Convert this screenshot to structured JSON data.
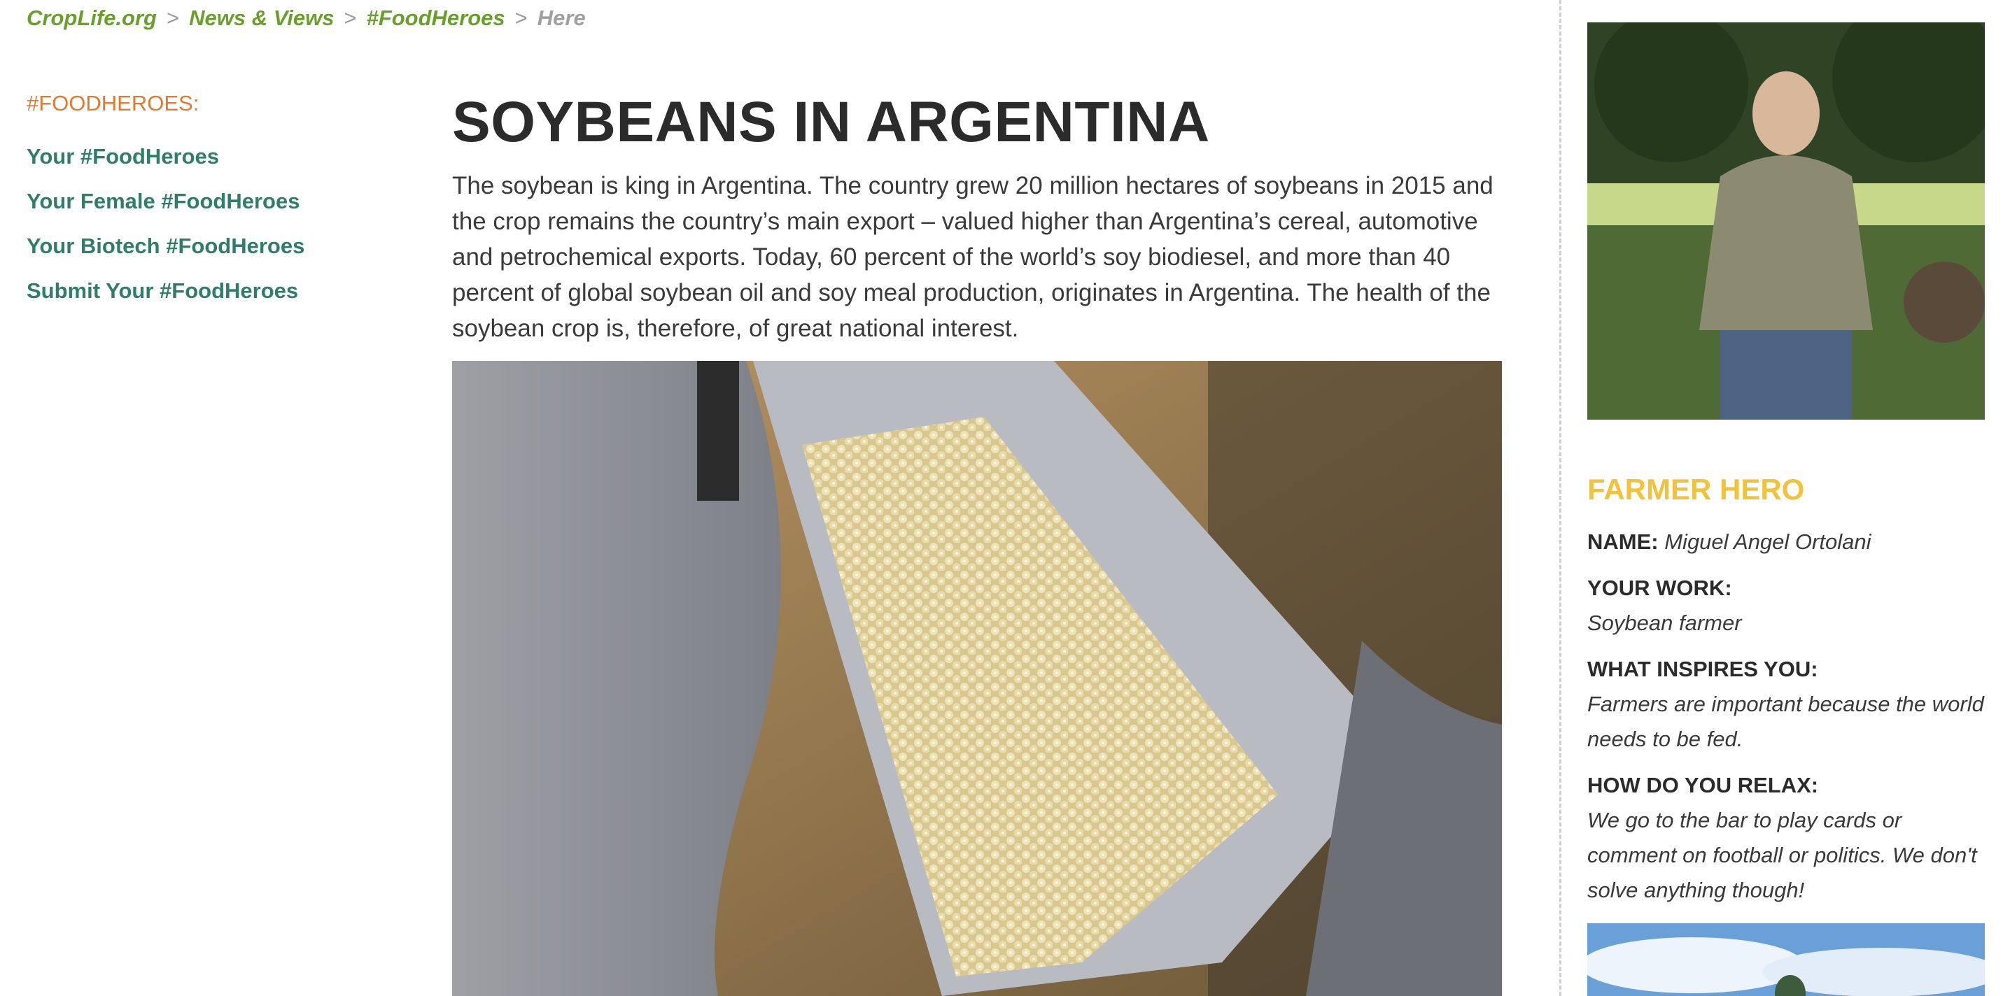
{
  "breadcrumb": {
    "items": [
      "CropLife.org",
      "News & Views",
      "#FoodHeroes"
    ],
    "current": "Here",
    "separator": ">"
  },
  "sidebar": {
    "heading": "#FOODHEROES:",
    "links": [
      "Your #FoodHeroes",
      "Your Female #FoodHeroes",
      "Your Biotech #FoodHeroes",
      "Submit Your #FoodHeroes"
    ]
  },
  "article": {
    "title": "SOYBEANS IN ARGENTINA",
    "intro": "The soybean is king in Argentina. The country grew 20 million hectares of soybeans in 2015 and the crop remains the country’s main export – valued higher than Argentina’s cereal, automotive and petrochemical exports. Today, 60 percent of the world’s soy biodiesel, and more than 40 percent of global soybean oil and soy meal production, originates in Argentina. The health of the soybean crop is, therefore, of great national interest."
  },
  "profile": {
    "title": "FARMER HERO",
    "name_label": "NAME:",
    "name_value": "Miguel Angel Ortolani",
    "work_label": "YOUR WORK:",
    "work_value": "Soybean farmer",
    "inspires_label": "WHAT INSPIRES YOU:",
    "inspires_value": "Farmers are important because the world needs to be fed.",
    "relax_label": "HOW DO YOU RELAX:",
    "relax_value": "We go to the bar to play cards or comment on football or politics. We don't solve anything though!"
  },
  "colors": {
    "breadcrumb_link": "#6a9f2c",
    "nav_heading": "#e07a2e",
    "nav_link": "#2f7d6a",
    "profile_title": "#f2c23a"
  }
}
